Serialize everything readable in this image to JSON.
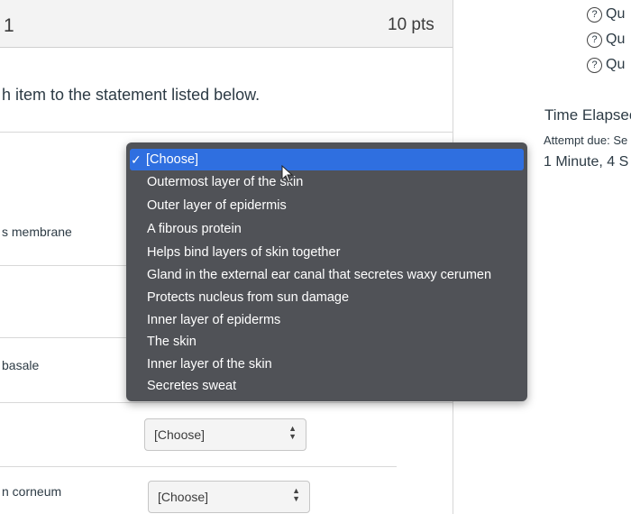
{
  "question": {
    "number": "1",
    "points": "10 pts",
    "prompt": "h item to the statement listed below.",
    "rows": [
      {
        "label": "s membrane"
      },
      {
        "label": "basale"
      },
      {
        "label": "n corneum"
      }
    ],
    "selects": [
      {
        "value": "[Choose]"
      },
      {
        "value": "[Choose]"
      }
    ]
  },
  "dropdown": {
    "selected": "[Choose]",
    "options": [
      "Outermost layer of the skin",
      "Outer layer of epidermis",
      "A fibrous protein",
      "Helps bind layers of skin together",
      "Gland in the external ear canal that secretes waxy cerumen",
      "Protects nucleus from sun damage",
      "Inner layer of epiderms",
      "The skin",
      "Inner layer of the skin",
      "Secretes sweat"
    ]
  },
  "sidebar": {
    "question_links": [
      "Qu",
      "Qu",
      "Qu"
    ],
    "time_title": "Time Elapsec",
    "attempt_due": "Attempt due: Se",
    "time_value": "1 Minute, 4 S"
  }
}
